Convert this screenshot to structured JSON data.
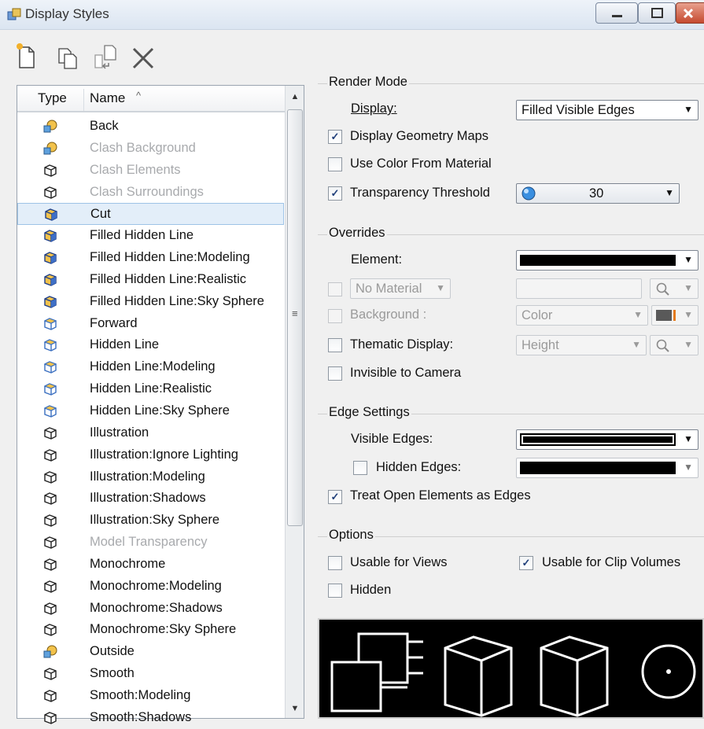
{
  "window": {
    "title": "Display Styles"
  },
  "toolbar": {
    "new_icon": "new-document-icon",
    "copy_icon": "copy-icon",
    "import_icon": "import-icon",
    "delete_icon": "delete-x-icon"
  },
  "list": {
    "columns": {
      "type": "Type",
      "name": "Name"
    },
    "sort_indicator": "^",
    "items": [
      {
        "name": "Back",
        "icon": "sphere-cube-icon",
        "disabled": false
      },
      {
        "name": "Clash Background",
        "icon": "sphere-cube-icon",
        "disabled": true
      },
      {
        "name": "Clash Elements",
        "icon": "wireframe-cube-icon",
        "disabled": true
      },
      {
        "name": "Clash Surroundings",
        "icon": "wireframe-cube-icon",
        "disabled": true
      },
      {
        "name": "Cut",
        "icon": "shaded-cube-icon",
        "disabled": false,
        "selected": true
      },
      {
        "name": "Filled Hidden Line",
        "icon": "shaded-cube-icon",
        "disabled": false
      },
      {
        "name": "Filled Hidden Line:Modeling",
        "icon": "shaded-cube-icon",
        "disabled": false
      },
      {
        "name": "Filled Hidden Line:Realistic",
        "icon": "shaded-cube-icon",
        "disabled": false
      },
      {
        "name": "Filled Hidden Line:Sky Sphere",
        "icon": "shaded-cube-icon",
        "disabled": false
      },
      {
        "name": "Forward",
        "icon": "outline-cube-icon",
        "disabled": false
      },
      {
        "name": "Hidden Line",
        "icon": "outline-cube-icon",
        "disabled": false
      },
      {
        "name": "Hidden Line:Modeling",
        "icon": "outline-cube-icon",
        "disabled": false
      },
      {
        "name": "Hidden Line:Realistic",
        "icon": "outline-cube-icon",
        "disabled": false
      },
      {
        "name": "Hidden Line:Sky Sphere",
        "icon": "outline-cube-icon",
        "disabled": false
      },
      {
        "name": "Illustration",
        "icon": "wireframe-cube-icon",
        "disabled": false
      },
      {
        "name": "Illustration:Ignore Lighting",
        "icon": "wireframe-cube-icon",
        "disabled": false
      },
      {
        "name": "Illustration:Modeling",
        "icon": "wireframe-cube-icon",
        "disabled": false
      },
      {
        "name": "Illustration:Shadows",
        "icon": "wireframe-cube-icon",
        "disabled": false
      },
      {
        "name": "Illustration:Sky Sphere",
        "icon": "wireframe-cube-icon",
        "disabled": false
      },
      {
        "name": "Model Transparency",
        "icon": "wireframe-cube-icon",
        "disabled": true
      },
      {
        "name": "Monochrome",
        "icon": "wireframe-cube-icon",
        "disabled": false
      },
      {
        "name": "Monochrome:Modeling",
        "icon": "wireframe-cube-icon",
        "disabled": false
      },
      {
        "name": "Monochrome:Shadows",
        "icon": "wireframe-cube-icon",
        "disabled": false
      },
      {
        "name": "Monochrome:Sky Sphere",
        "icon": "wireframe-cube-icon",
        "disabled": false
      },
      {
        "name": "Outside",
        "icon": "sphere-cube-icon",
        "disabled": false
      },
      {
        "name": "Smooth",
        "icon": "wireframe-cube-icon",
        "disabled": false
      },
      {
        "name": "Smooth:Modeling",
        "icon": "wireframe-cube-icon",
        "disabled": false
      },
      {
        "name": "Smooth:Shadows",
        "icon": "wireframe-cube-icon",
        "disabled": false
      }
    ]
  },
  "render_mode": {
    "title": "Render Mode",
    "display_label": "Display:",
    "display_value": "Filled Visible Edges",
    "display_geometry_maps": {
      "label": "Display Geometry Maps",
      "checked": true
    },
    "use_color_from_material": {
      "label": "Use Color From Material",
      "checked": false
    },
    "transparency_threshold": {
      "label": "Transparency Threshold",
      "checked": true,
      "value": "30"
    }
  },
  "overrides": {
    "title": "Overrides",
    "element_label": "Element:",
    "material_value": "No Material",
    "background_label": "Background :",
    "background_value": "Color",
    "thematic_label": "Thematic Display:",
    "thematic_value": "Height",
    "invisible_label": "Invisible to Camera",
    "element_color": "#000000",
    "background_color": "#595959"
  },
  "edge_settings": {
    "title": "Edge Settings",
    "visible_label": "Visible Edges:",
    "hidden_label": "Hidden Edges:",
    "hidden_checked": false,
    "treat_open_label": "Treat Open Elements as Edges",
    "treat_open_checked": true
  },
  "options": {
    "title": "Options",
    "usable_views": {
      "label": "Usable for Views",
      "checked": false
    },
    "usable_clip": {
      "label": "Usable for Clip Volumes",
      "checked": true
    },
    "hidden": {
      "label": "Hidden",
      "checked": false
    }
  },
  "check_mark": "✓"
}
